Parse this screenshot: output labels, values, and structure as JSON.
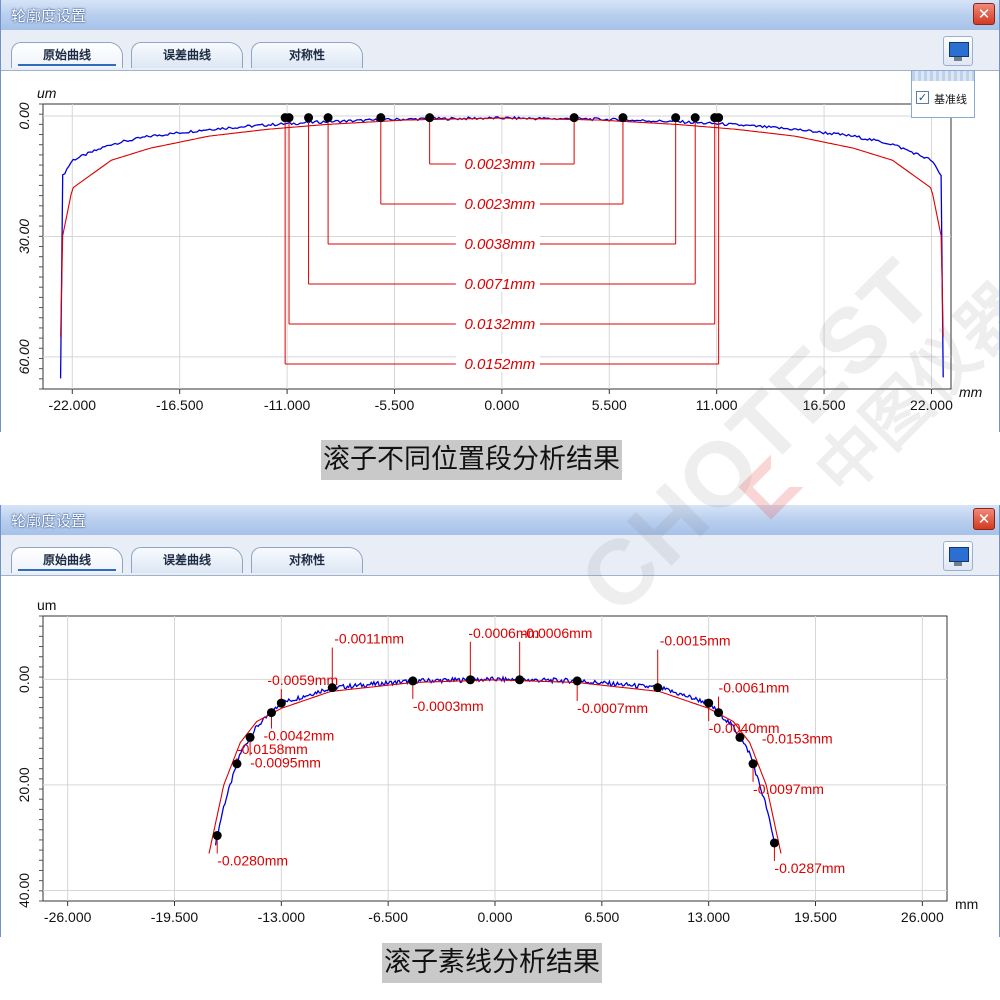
{
  "windows": [
    {
      "title": "轮廓度设置",
      "tabs": [
        "原始曲线",
        "误差曲线",
        "对称性"
      ],
      "legend": {
        "label": "基准线",
        "checked": true
      },
      "caption": "滚子不同位置段分析结果"
    },
    {
      "title": "轮廓度设置",
      "tabs": [
        "原始曲线",
        "误差曲线",
        "对称性"
      ],
      "caption": "滚子素线分析结果"
    }
  ],
  "close_glyph": "✕",
  "icons": {
    "monitor": "monitor-icon",
    "close": "close-icon",
    "check": "check-icon"
  },
  "colors": {
    "measured": "#0000dd",
    "reference": "#dd0000",
    "annotation": "#dd0000",
    "title_bar": "#b9cfee",
    "close_button": "#d23a22"
  },
  "watermark": {
    "text": "CHOTEST",
    "cn": "中图仪器"
  },
  "chart_data": [
    {
      "type": "line",
      "xlabel": "mm",
      "ylabel": "um",
      "xlim": [
        -23.5,
        23.0
      ],
      "ylim": [
        -68,
        3
      ],
      "y_inverted_display": true,
      "x_ticks": [
        "-22.000",
        "-16.500",
        "-11.000",
        "-5.500",
        "0.000",
        "5.500",
        "11.000",
        "16.500",
        "22.000"
      ],
      "y_ticks": [
        "0.00",
        "30.00",
        "60.00"
      ],
      "series": [
        {
          "color": "blue",
          "x": [
            -22.6,
            -22.5,
            -22.0,
            -20,
            -18,
            -15,
            -12,
            -9,
            -5,
            0,
            5,
            9,
            12,
            15,
            18,
            20,
            22.0,
            22.5,
            22.6
          ],
          "y": [
            -65,
            -15,
            -11,
            -7,
            -5,
            -3.3,
            -2.2,
            -1.4,
            -0.8,
            -0.5,
            -0.8,
            -1.4,
            -2.2,
            -3.3,
            -5,
            -7,
            -11,
            -15,
            -65
          ]
        },
        {
          "color": "red",
          "x": [
            -22.6,
            -22.5,
            -22.0,
            -20,
            -18,
            -15,
            -12,
            -9,
            -5,
            0,
            5,
            9,
            12,
            15,
            18,
            20,
            22.0,
            22.5,
            22.6
          ],
          "y": [
            -55,
            -30,
            -18,
            -11,
            -8,
            -5,
            -3.3,
            -2.1,
            -1.0,
            -0.5,
            -1.0,
            -2.1,
            -3.3,
            -5,
            -8,
            -11,
            -18,
            -30,
            -55
          ]
        }
      ],
      "segments": [
        {
          "x1": -3.7,
          "x2": 3.7,
          "label": "0.0023mm"
        },
        {
          "x1": -6.2,
          "x2": 6.2,
          "label": "0.0023mm"
        },
        {
          "x1": -8.9,
          "x2": 8.9,
          "label": "0.0038mm"
        },
        {
          "x1": -9.9,
          "x2": 9.9,
          "label": "0.0071mm"
        },
        {
          "x1": -10.9,
          "x2": 10.9,
          "label": "0.0132mm"
        },
        {
          "x1": -11.1,
          "x2": 11.1,
          "label": "0.0152mm"
        }
      ]
    },
    {
      "type": "line",
      "xlabel": "mm",
      "ylabel": "um",
      "xlim": [
        -27.5,
        27.5
      ],
      "ylim": [
        -42,
        12
      ],
      "x_ticks": [
        "-26.000",
        "-19.500",
        "-13.000",
        "-6.500",
        "0.000",
        "6.500",
        "13.000",
        "19.500",
        "26.000"
      ],
      "y_ticks": [
        "0.00",
        "20.00",
        "40.00"
      ],
      "series": [
        {
          "color": "blue",
          "x": [
            -17.0,
            -16.5,
            -15.5,
            -14.5,
            -13.0,
            -10.0,
            -5.0,
            0,
            5.0,
            10.0,
            13.0,
            14.5,
            15.5,
            16.5,
            17.0
          ],
          "y": [
            -31,
            -24,
            -14,
            -9,
            -4.5,
            -1.6,
            -0.3,
            0,
            -0.3,
            -1.6,
            -4.5,
            -9,
            -14,
            -24,
            -31
          ]
        },
        {
          "color": "red",
          "x": [
            -17.4,
            -16.5,
            -15.5,
            -14.5,
            -13.0,
            -10.0,
            -5.0,
            0,
            5.0,
            10.0,
            13.0,
            14.5,
            15.5,
            16.5,
            17.4
          ],
          "y": [
            -33,
            -20,
            -12,
            -8,
            -5.5,
            -2.3,
            -0.6,
            -0.1,
            -0.6,
            -2.3,
            -5.5,
            -8,
            -12,
            -20,
            -33
          ]
        }
      ],
      "points": [
        {
          "x": -16.9,
          "label": "-0.0280mm"
        },
        {
          "x": -15.7,
          "label": "-0.0158mm"
        },
        {
          "x": -14.9,
          "label": "-0.0095mm"
        },
        {
          "x": -13.6,
          "label": "-0.0042mm"
        },
        {
          "x": -13.0,
          "label": "-0.0059mm"
        },
        {
          "x": -9.9,
          "label": "-0.0011mm"
        },
        {
          "x": -5.0,
          "label": "-0.0003mm"
        },
        {
          "x": -1.5,
          "label": "-0.0006mm"
        },
        {
          "x": 1.5,
          "label": "-0.0006mm"
        },
        {
          "x": 5.0,
          "label": "-0.0007mm"
        },
        {
          "x": 9.9,
          "label": "-0.0015mm"
        },
        {
          "x": 13.0,
          "label": "-0.0040mm"
        },
        {
          "x": 13.6,
          "label": "-0.0061mm"
        },
        {
          "x": 14.9,
          "label": "-0.0153mm"
        },
        {
          "x": 15.7,
          "label": "-0.0097mm"
        },
        {
          "x": 17.0,
          "label": "-0.0287mm"
        }
      ]
    }
  ]
}
